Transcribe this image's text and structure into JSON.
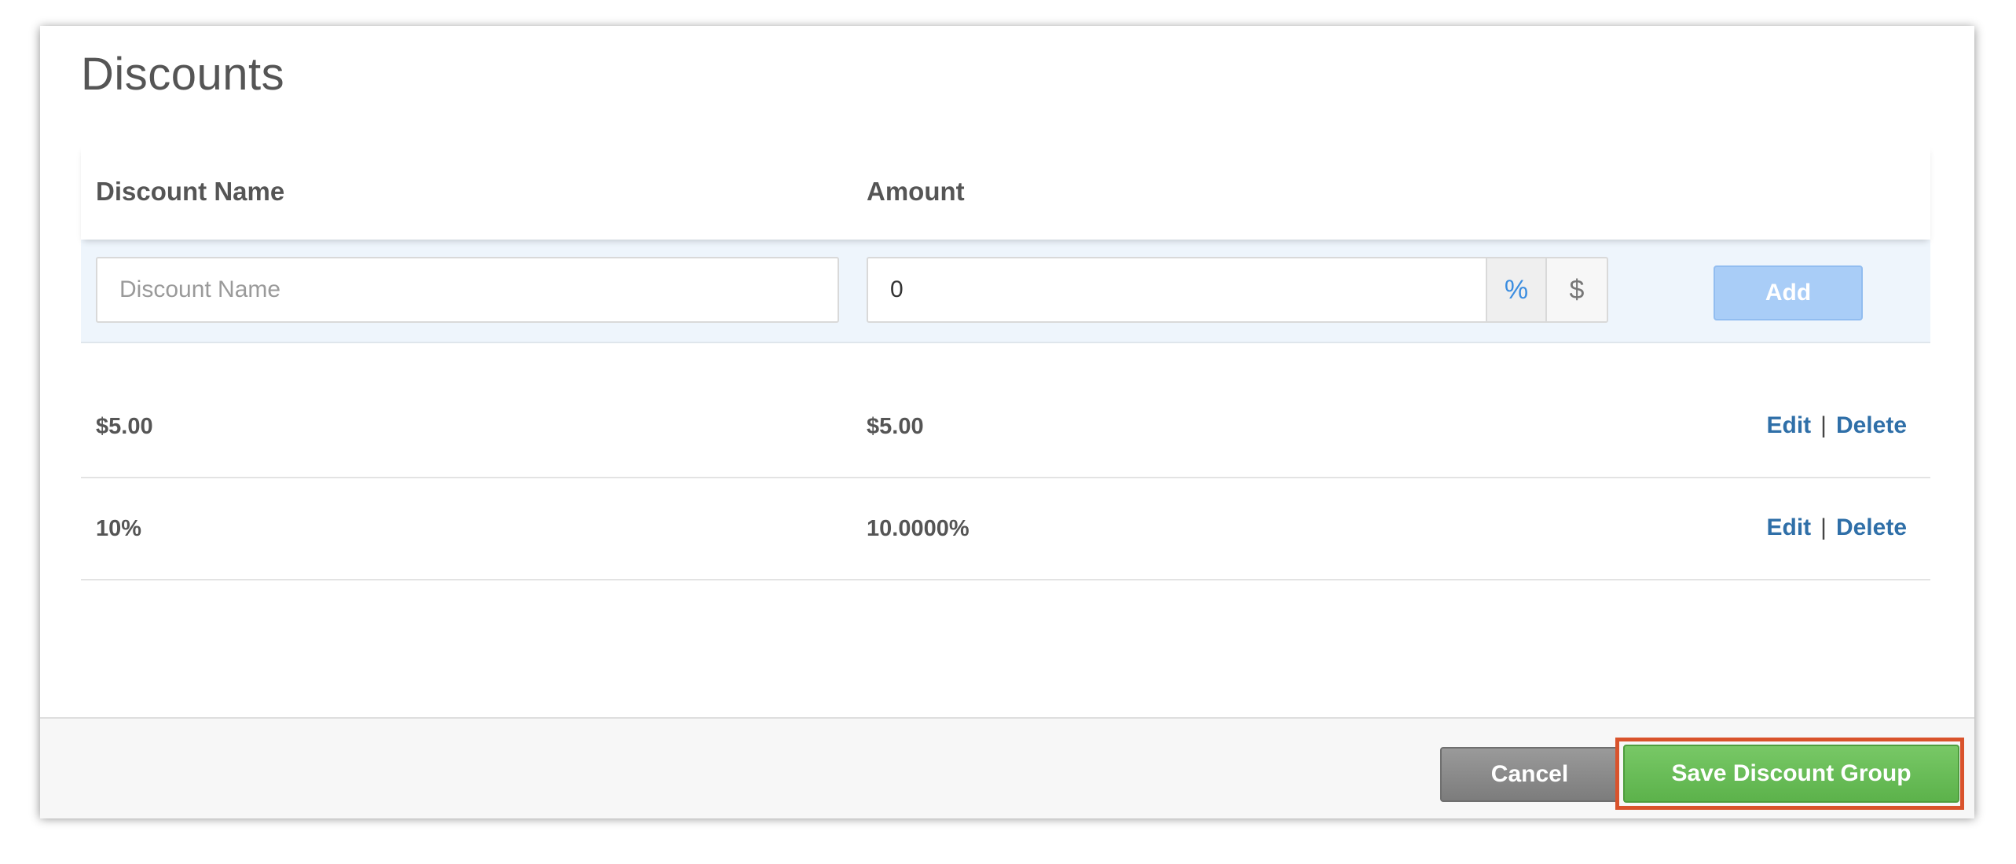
{
  "modal": {
    "title": "Discounts",
    "table": {
      "headers": {
        "name": "Discount Name",
        "amount": "Amount"
      },
      "add_row": {
        "name_placeholder": "Discount Name",
        "amount_value": "0",
        "percent_symbol": "%",
        "dollar_symbol": "$",
        "selected_unit": "percent",
        "add_label": "Add"
      },
      "rows": [
        {
          "name": "$5.00",
          "amount": "$5.00",
          "edit": "Edit",
          "separator": "|",
          "delete": "Delete"
        },
        {
          "name": "10%",
          "amount": "10.0000%",
          "edit": "Edit",
          "separator": "|",
          "delete": "Delete"
        }
      ]
    },
    "footer": {
      "cancel_label": "Cancel",
      "save_label": "Save Discount Group"
    }
  },
  "colors": {
    "link": "#2f6fa8",
    "add_button": "#a9cdf7",
    "save_button": "#5cb24b",
    "highlight": "#d9532c",
    "add_row_bg": "#eef5fc"
  }
}
